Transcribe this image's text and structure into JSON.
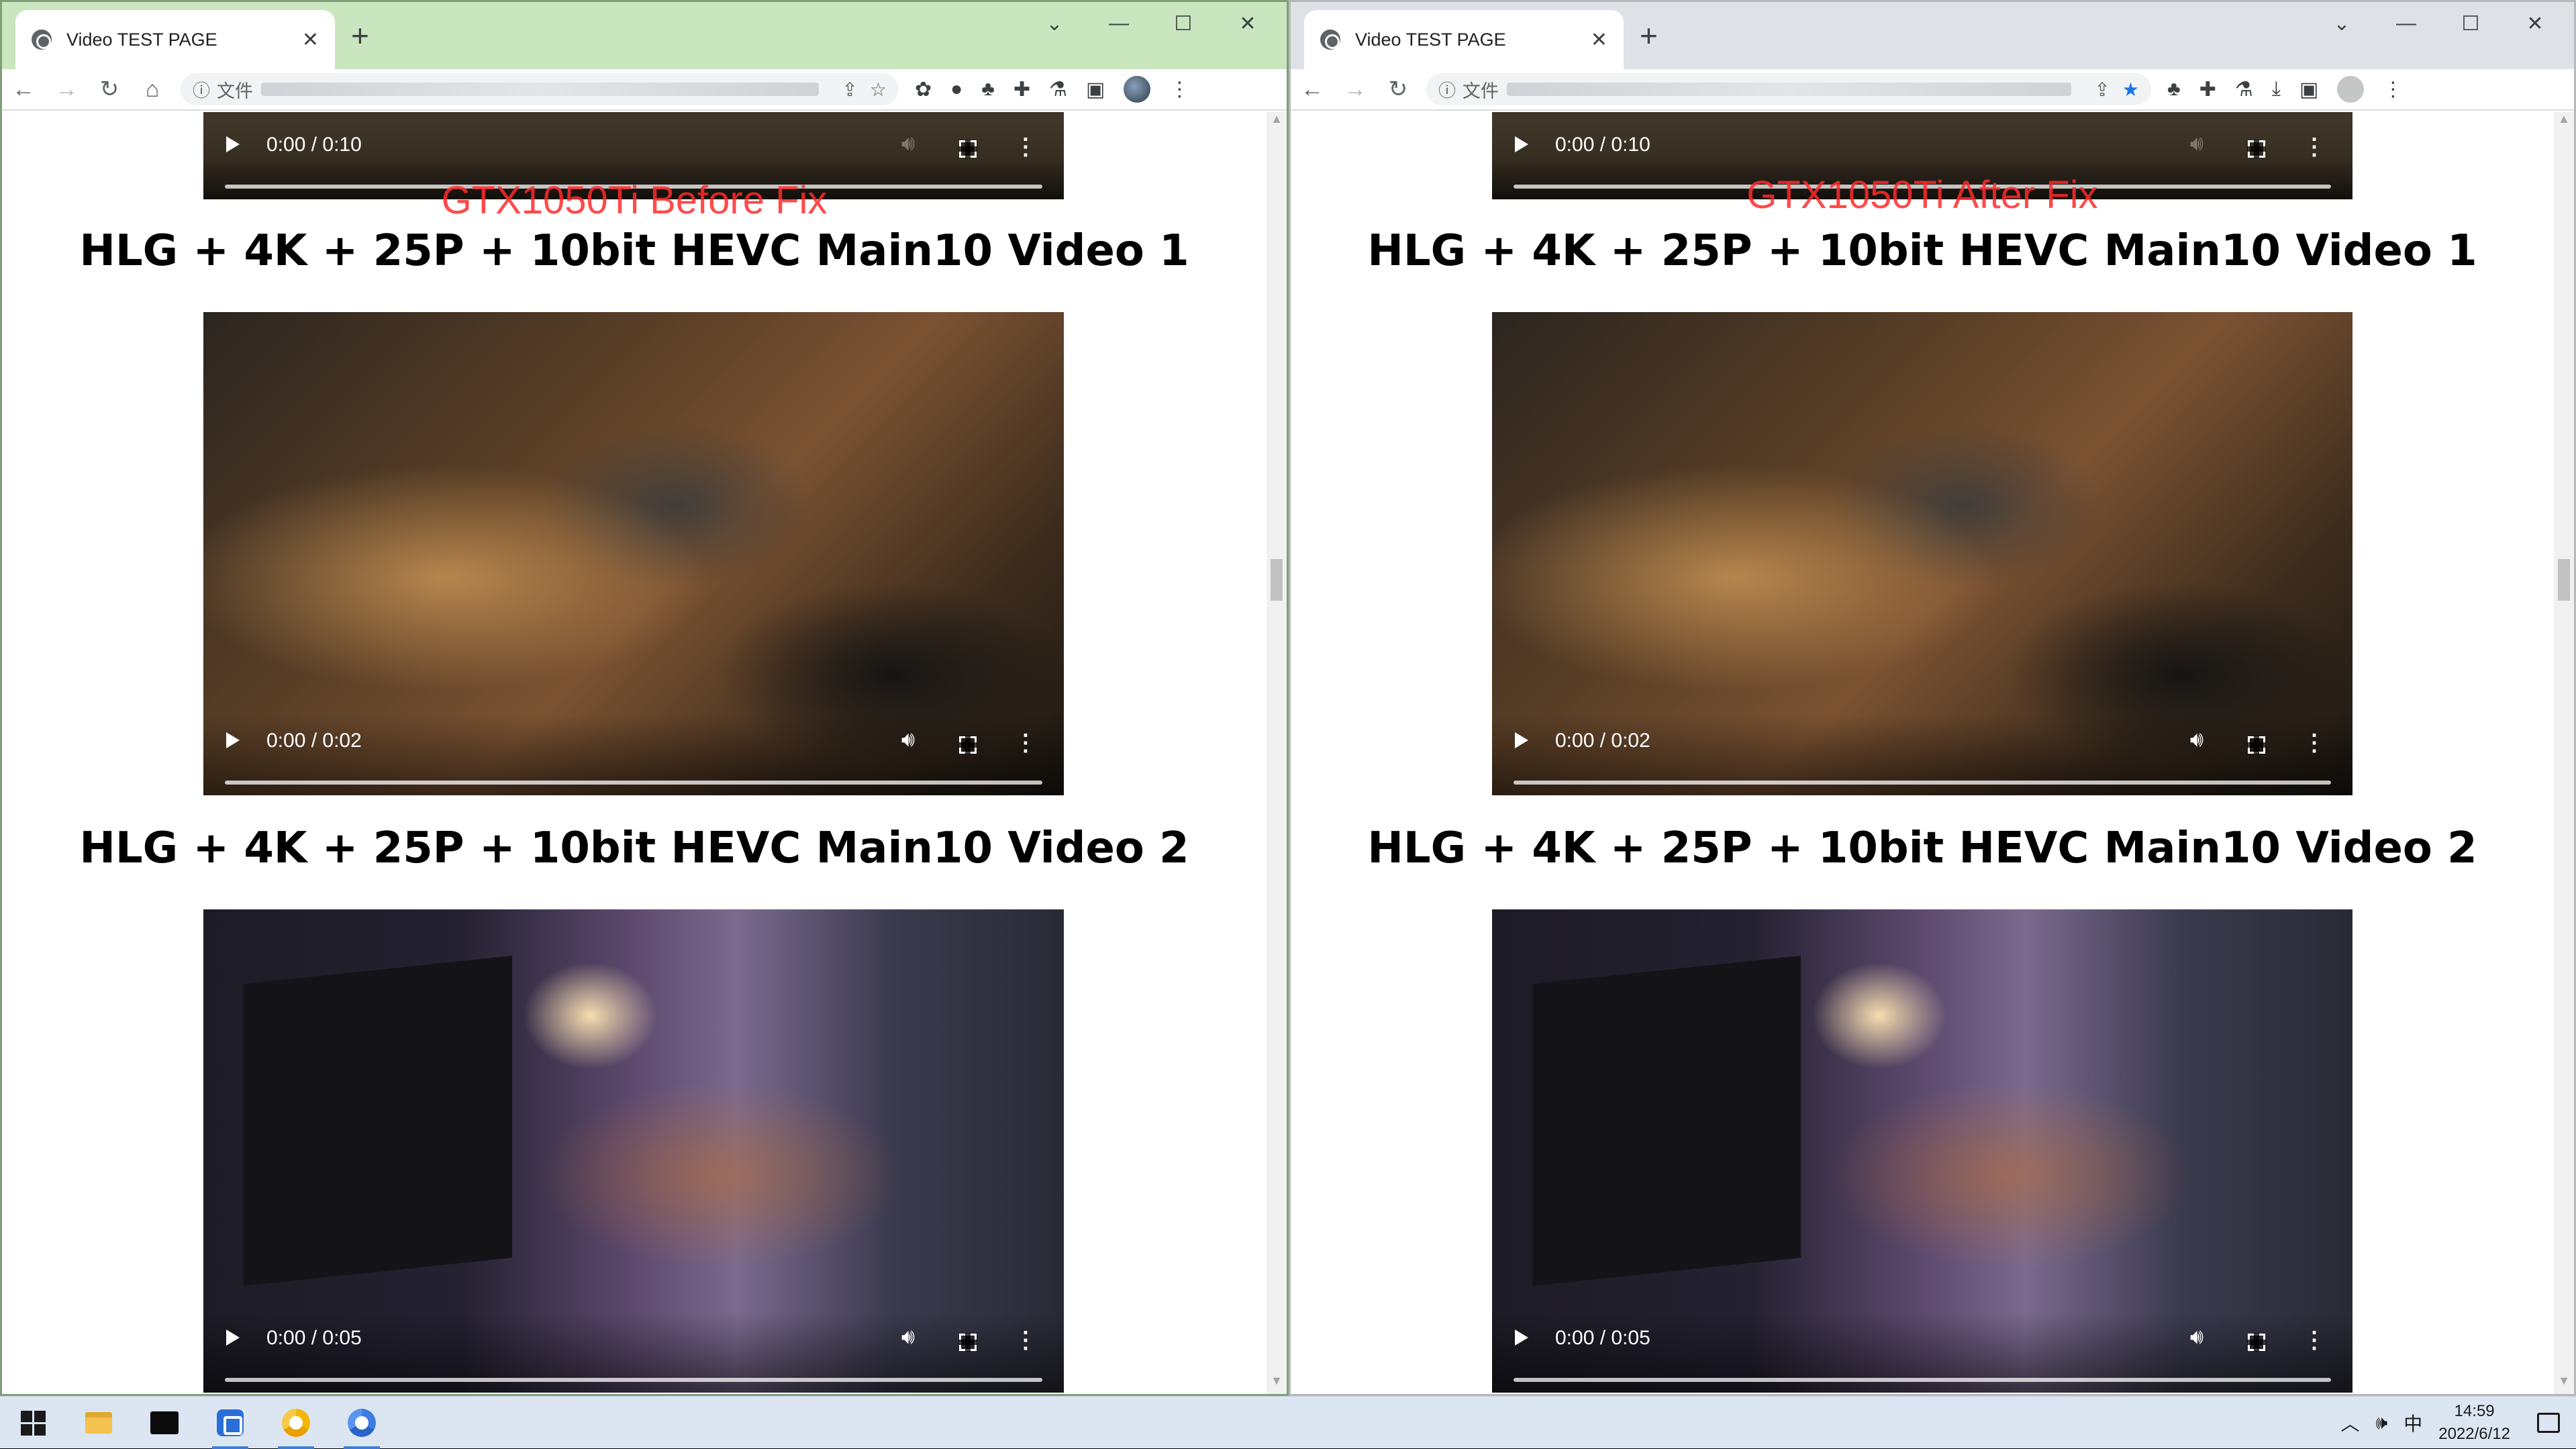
{
  "windows": [
    {
      "tab_title": "Video TEST PAGE",
      "address_scheme": "文件",
      "overlay_label": "GTX1050Ti Before Fix",
      "top_video_time": "0:00 / 0:10",
      "videos": [
        {
          "heading": "HLG + 4K + 25P + 10bit HEVC Main10 Video 1",
          "time": "0:00 / 0:02"
        },
        {
          "heading": "HLG + 4K + 25P + 10bit HEVC Main10 Video 2",
          "time": "0:00 / 0:05"
        }
      ]
    },
    {
      "tab_title": "Video TEST PAGE",
      "address_scheme": "文件",
      "overlay_label": "GTX1050Ti After Fix",
      "top_video_time": "0:00 / 0:10",
      "videos": [
        {
          "heading": "HLG + 4K + 25P + 10bit HEVC Main10 Video 1",
          "time": "0:00 / 0:02"
        },
        {
          "heading": "HLG + 4K + 25P + 10bit HEVC Main10 Video 2",
          "time": "0:00 / 0:05"
        }
      ]
    }
  ],
  "taskbar": {
    "tray_ime": "中",
    "clock_time": "14:59",
    "clock_date": "2022/6/12"
  },
  "icons": {
    "back": "arrow-left-icon",
    "forward": "arrow-right-icon",
    "reload": "reload-icon",
    "home": "home-icon",
    "share": "share-icon",
    "bookmark": "star-icon",
    "extensions": "puzzle-icon"
  },
  "colors": {
    "overlay_label": "#ff2b2b",
    "left_titlebar": "#c9e6bf",
    "right_titlebar": "#dee1e6",
    "bookmark_active": "#1a73e8"
  }
}
